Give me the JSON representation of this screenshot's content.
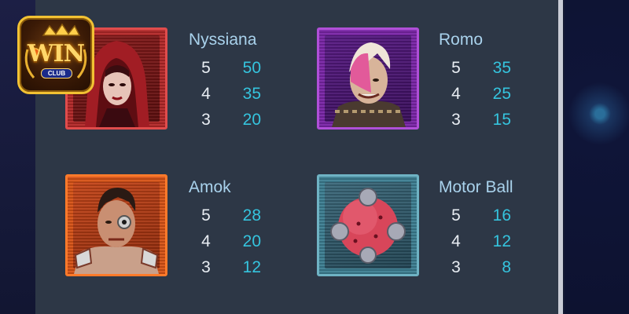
{
  "logo": {
    "brand": "WIN",
    "badge": "CLUB",
    "icon": "crown-logo-icon"
  },
  "symbols": [
    {
      "name": "Nyssiana",
      "icon": "hooded-woman-icon",
      "color": "#e04c4c",
      "payouts": [
        {
          "count": "5",
          "value": "50"
        },
        {
          "count": "4",
          "value": "35"
        },
        {
          "count": "3",
          "value": "20"
        }
      ]
    },
    {
      "name": "Romo",
      "icon": "punk-man-icon",
      "color": "#b04fd8",
      "payouts": [
        {
          "count": "5",
          "value": "35"
        },
        {
          "count": "4",
          "value": "25"
        },
        {
          "count": "3",
          "value": "15"
        }
      ]
    },
    {
      "name": "Amok",
      "icon": "cyborg-man-icon",
      "color": "#ff7a2a",
      "payouts": [
        {
          "count": "5",
          "value": "28"
        },
        {
          "count": "4",
          "value": "20"
        },
        {
          "count": "3",
          "value": "12"
        }
      ]
    },
    {
      "name": "Motor Ball",
      "icon": "spiked-ball-icon",
      "color": "#6fb3c4",
      "payouts": [
        {
          "count": "5",
          "value": "16"
        },
        {
          "count": "4",
          "value": "12"
        },
        {
          "count": "3",
          "value": "8"
        }
      ]
    }
  ],
  "colors": {
    "panel": "#2d3746",
    "name_text": "#a9d2ec",
    "count_text": "#e8edf3",
    "value_text": "#35c4de"
  }
}
